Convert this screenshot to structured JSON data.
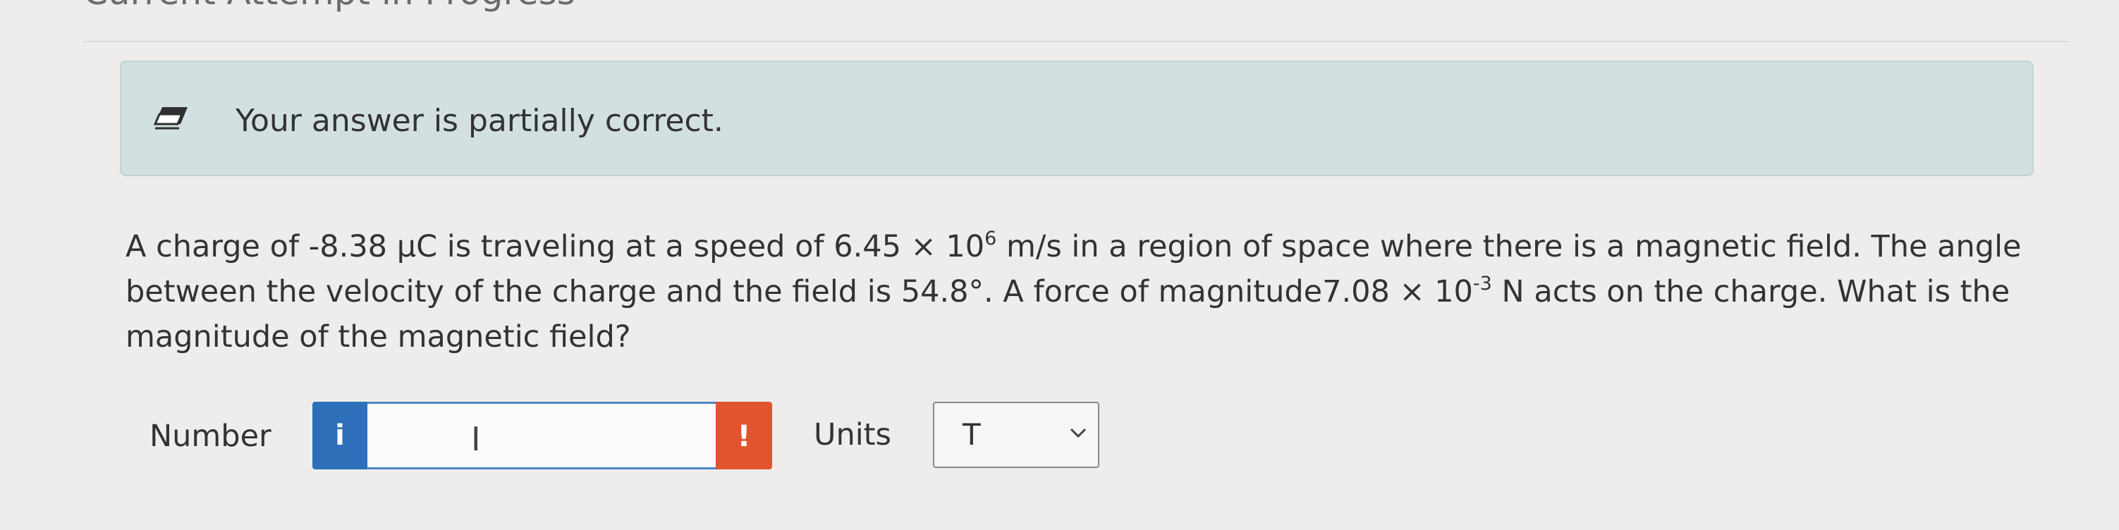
{
  "header": {
    "attempt_title": "Current Attempt in Progress"
  },
  "feedback": {
    "icon": "eraser-icon",
    "message": "Your answer is partially correct."
  },
  "question": {
    "part1": "A charge of -8.38 μC is traveling at a speed of 6.45 × 10",
    "exp1": "6",
    "part2": " m/s in a region of space where there is a magnetic field. The angle between the velocity of the charge and the field is 54.8°. A force of magnitude7.08 × 10",
    "exp2": "-3",
    "part3": " N acts on the charge. What is the magnitude of the magnetic field?"
  },
  "answer": {
    "number_label": "Number",
    "info_button": "i",
    "number_value": "",
    "warning_button": "!",
    "units_label": "Units",
    "units_selected": "T"
  },
  "colors": {
    "banner_bg": "#d2e0e2",
    "info_blue": "#2d6fb8",
    "warning_red": "#e0542f"
  }
}
